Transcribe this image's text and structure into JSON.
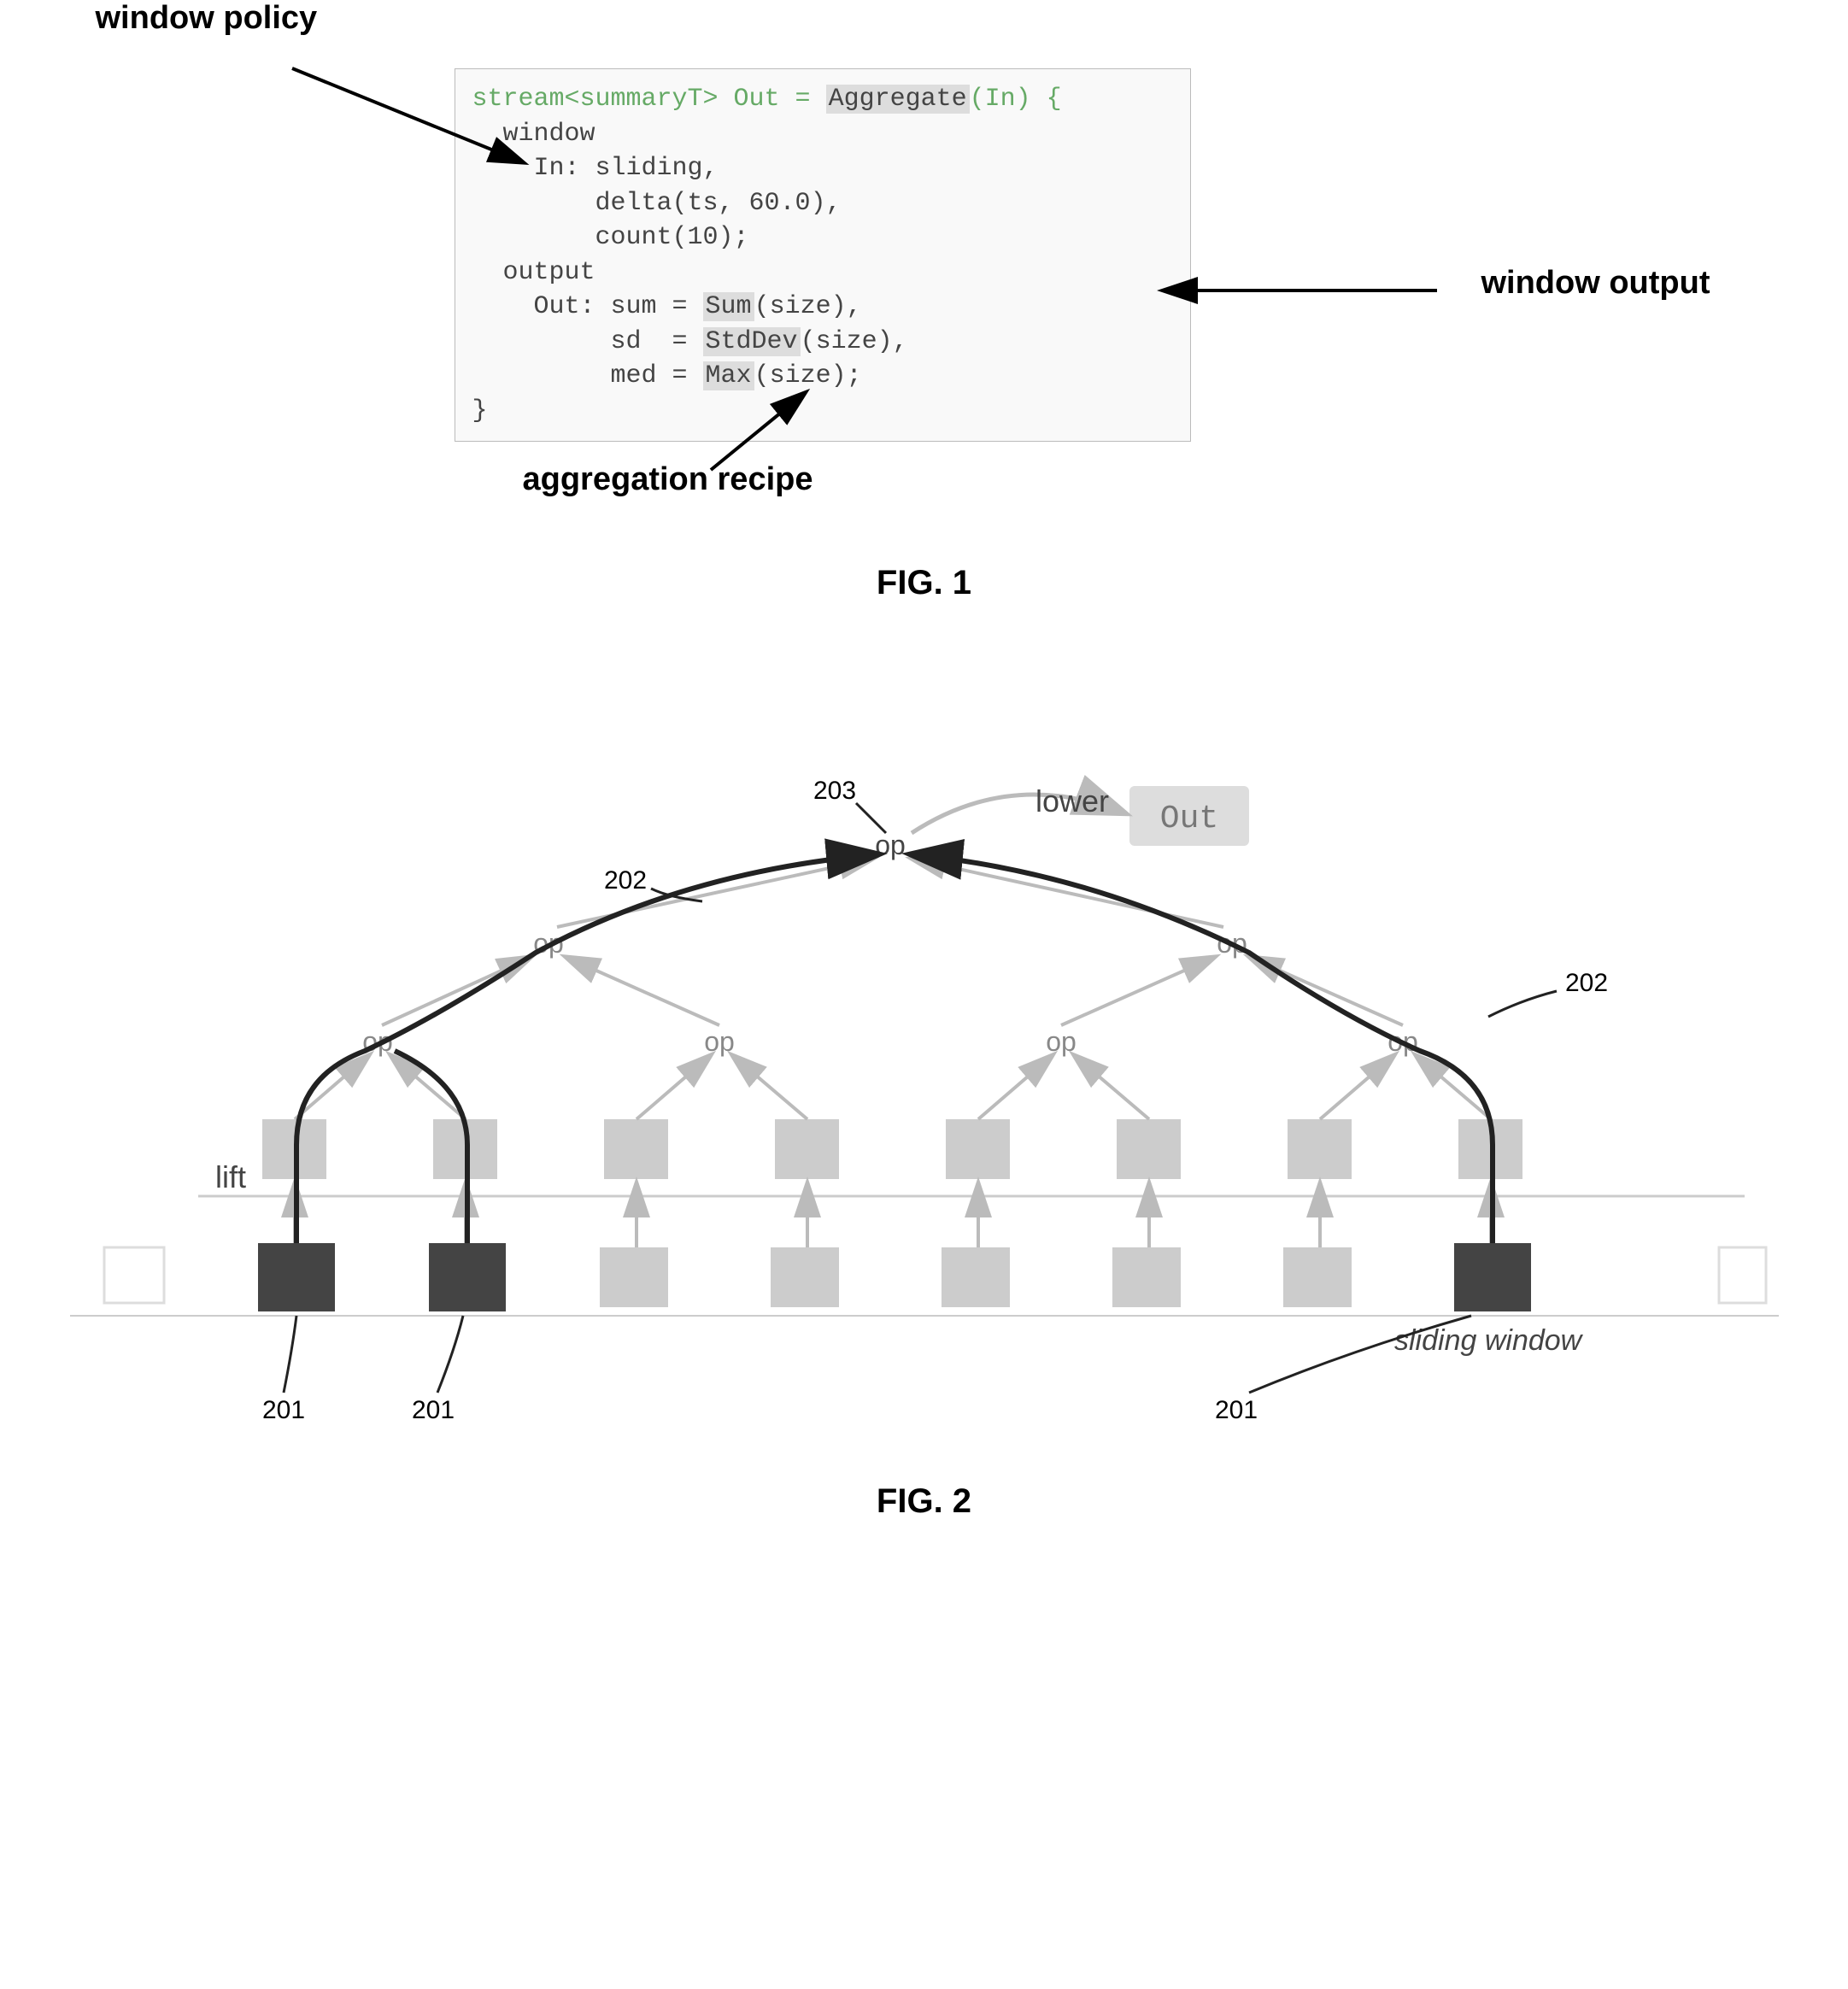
{
  "fig1": {
    "label_window_policy": "window policy",
    "label_window_output": "window output",
    "label_aggregation_recipe": "aggregation recipe",
    "code": {
      "line1_pre": "stream<summaryT> Out = ",
      "line1_hl": "Aggregate",
      "line1_post": "(In) {",
      "line2": "  window",
      "line3": "    In: sliding,",
      "line4": "        delta(ts, 60.0),",
      "line5": "        count(10);",
      "line6": "  output",
      "line7_pre": "    Out: sum = ",
      "line7_hl": "Sum",
      "line7_post": "(size),",
      "line8_pre": "         sd  = ",
      "line8_hl": "StdDev",
      "line8_post": "(size),",
      "line9_pre": "         med = ",
      "line9_hl": "Max",
      "line9_post": "(size);",
      "line10": "}"
    },
    "caption": "FIG. 1"
  },
  "fig2": {
    "caption": "FIG. 2",
    "label_lower": "lower",
    "label_out": "Out",
    "label_lift": "lift",
    "label_sliding_window": "sliding window",
    "op_label": "op",
    "ref_201": "201",
    "ref_202": "202",
    "ref_203": "203"
  }
}
